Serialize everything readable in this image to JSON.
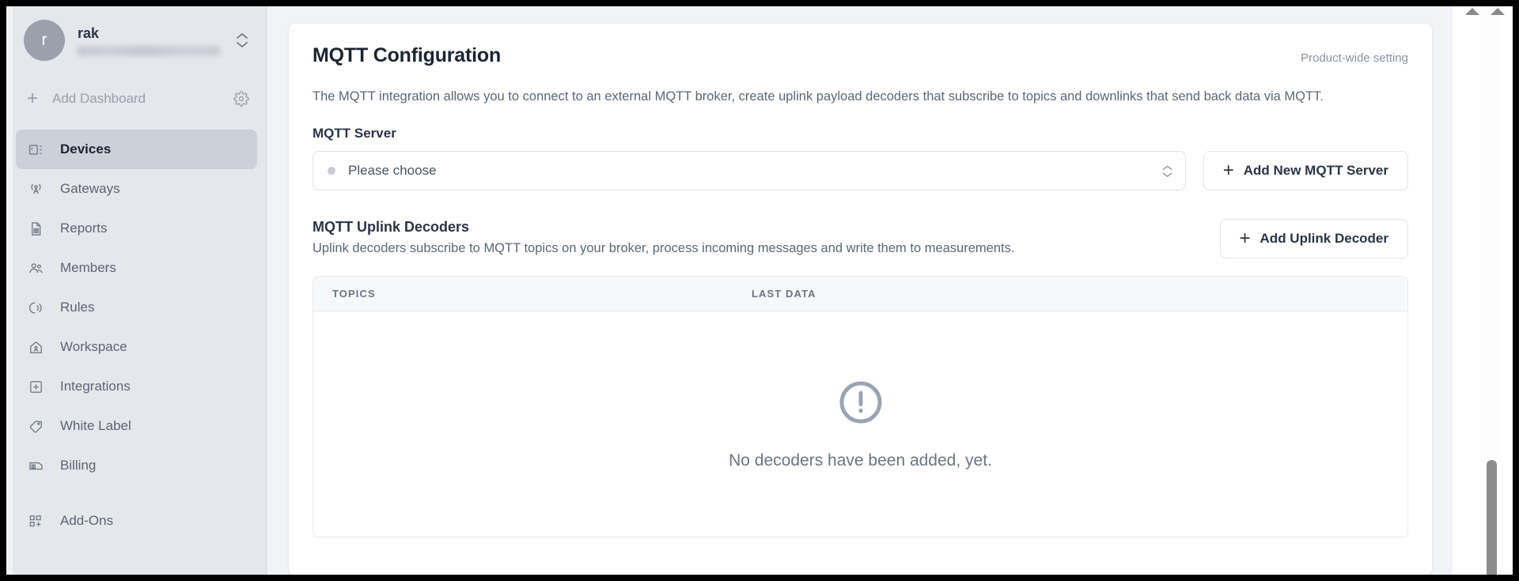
{
  "sidebar": {
    "workspace": {
      "avatar_initial": "r",
      "name": "rak",
      "email_redacted": "",
      "switcher_icon": "chevron-up-down-icon"
    },
    "add_dashboard": {
      "label": "Add Dashboard",
      "plus": "+",
      "settings_icon": "gear-icon"
    },
    "items": [
      {
        "label": "Devices",
        "icon": "devices-icon",
        "active": true
      },
      {
        "label": "Gateways",
        "icon": "gateway-antenna-icon",
        "active": false
      },
      {
        "label": "Reports",
        "icon": "report-document-icon",
        "active": false
      },
      {
        "label": "Members",
        "icon": "members-people-icon",
        "active": false
      },
      {
        "label": "Rules",
        "icon": "rules-signal-icon",
        "active": false
      },
      {
        "label": "Workspace",
        "icon": "workspace-home-icon",
        "active": false
      },
      {
        "label": "Integrations",
        "icon": "integrations-plus-box-icon",
        "active": false
      },
      {
        "label": "White Label",
        "icon": "white-label-tag-icon",
        "active": false
      },
      {
        "label": "Billing",
        "icon": "billing-cheque-icon",
        "active": false
      },
      {
        "label": "Add-Ons",
        "icon": "add-ons-grid-icon",
        "active": false
      }
    ]
  },
  "main": {
    "title": "MQTT Configuration",
    "scope_note": "Product-wide setting",
    "description": "The MQTT integration allows you to connect to an external MQTT broker, create uplink payload decoders that subscribe to topics and downlinks that send back data via MQTT.",
    "server": {
      "label": "MQTT Server",
      "selected_value": "Please choose",
      "status_dot_color": "#c7ccd4",
      "dropdown_icon": "chevron-up-down-icon",
      "add_button": {
        "plus": "+",
        "label": "Add New MQTT Server"
      }
    },
    "decoders": {
      "title": "MQTT Uplink Decoders",
      "subtitle": "Uplink decoders subscribe to MQTT topics on your broker, process incoming messages and write them to measurements.",
      "add_button": {
        "plus": "+",
        "label": "Add Uplink Decoder"
      },
      "table": {
        "columns": [
          "TOPICS",
          "LAST DATA"
        ],
        "rows": [],
        "empty_state": {
          "icon": "alert-circle-icon",
          "message": "No decoders have been added, yet."
        }
      }
    }
  },
  "scrollbar": {
    "up_arrow_icon": "triangle-up-icon",
    "position": "bottom"
  },
  "colors": {
    "sidebar_bg": "#e4e7eb",
    "canvas_bg": "#f1f3f6",
    "card_bg": "#ffffff",
    "text_primary": "#1d2430",
    "text_muted": "#6b7585"
  }
}
